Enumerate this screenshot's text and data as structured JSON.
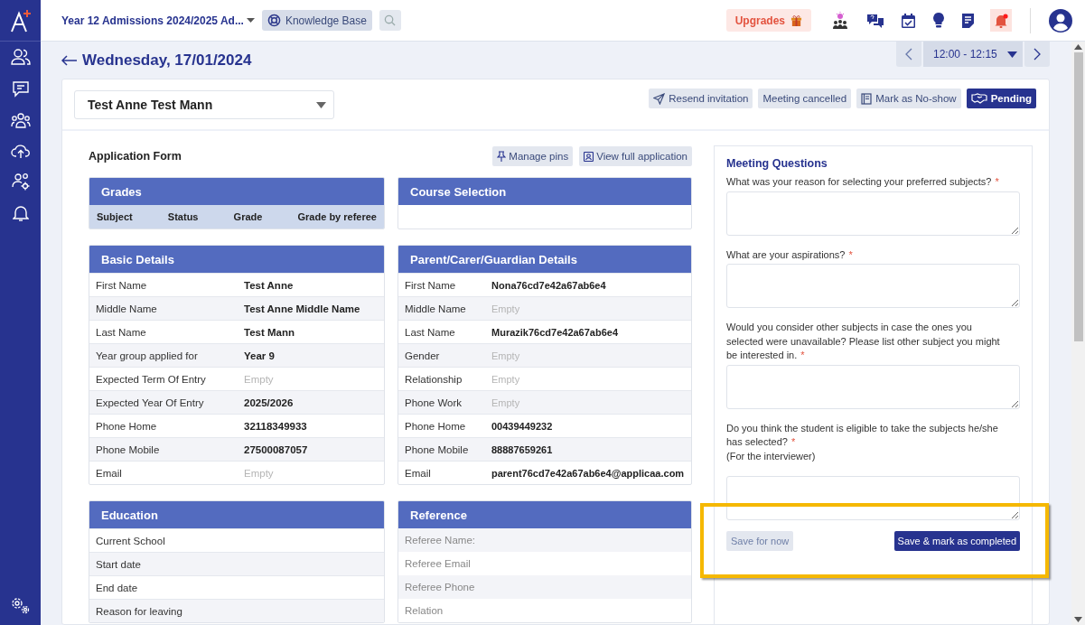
{
  "topbar": {
    "program": "Year 12 Admissions 2024/2025 Ad...",
    "knowledge_base": "Knowledge Base",
    "upgrades": "Upgrades",
    "notifications_unread": true
  },
  "header": {
    "date": "Wednesday, 17/01/2024",
    "time_slot": "12:00 - 12:15"
  },
  "applicant": {
    "name": "Test Anne Test Mann"
  },
  "actions": [
    {
      "label": "Resend invitation",
      "kind": "resend",
      "selected": false
    },
    {
      "label": "Meeting cancelled",
      "kind": "plain",
      "selected": false
    },
    {
      "label": "Mark as No-show",
      "kind": "noshow",
      "selected": false
    },
    {
      "label": "Pending",
      "kind": "pending",
      "selected": true
    }
  ],
  "application_form": {
    "title": "Application Form",
    "buttons": [
      {
        "label": "Manage pins",
        "kind": "pin"
      },
      {
        "label": "View full application",
        "kind": "view"
      }
    ],
    "sections": [
      {
        "title": "Grades",
        "kind": "columns",
        "columns": [
          "Subject",
          "Status",
          "Grade",
          "Grade by referee"
        ]
      },
      {
        "title": "Course Selection",
        "kind": "blank"
      },
      {
        "title": "Basic Details",
        "kind": "details",
        "rows": [
          {
            "label": "First Name",
            "value": "Test Anne",
            "empty": false
          },
          {
            "label": "Middle Name",
            "value": "Test Anne Middle Name",
            "empty": false
          },
          {
            "label": "Last Name",
            "value": "Test Mann",
            "empty": false
          },
          {
            "label": "Year group applied for",
            "value": "Year 9",
            "empty": false
          },
          {
            "label": "Expected Term Of Entry",
            "value": "Empty",
            "empty": true
          },
          {
            "label": "Expected Year Of Entry",
            "value": "2025/2026",
            "empty": false
          },
          {
            "label": "Phone Home",
            "value": "32118349933",
            "empty": false
          },
          {
            "label": "Phone Mobile",
            "value": "27500087057",
            "empty": false
          },
          {
            "label": "Email",
            "value": "Empty",
            "empty": true
          }
        ]
      },
      {
        "title": "Parent/Carer/Guardian Details",
        "kind": "details",
        "rows": [
          {
            "label": "First Name",
            "value": "Nona76cd7e42a67ab6e4",
            "empty": false
          },
          {
            "label": "Middle Name",
            "value": "Empty",
            "empty": true
          },
          {
            "label": "Last Name",
            "value": "Murazik76cd7e42a67ab6e4",
            "empty": false
          },
          {
            "label": "Gender",
            "value": "Empty",
            "empty": true
          },
          {
            "label": "Relationship",
            "value": "Empty",
            "empty": true
          },
          {
            "label": "Phone Work",
            "value": "Empty",
            "empty": true
          },
          {
            "label": "Phone Home",
            "value": "00439449232",
            "empty": false
          },
          {
            "label": "Phone Mobile",
            "value": "88887659261",
            "empty": false
          },
          {
            "label": "Email",
            "value": "parent76cd7e42a67ab6e4@applicaa.com",
            "empty": false
          }
        ]
      },
      {
        "title": "Education",
        "kind": "list",
        "muted": false,
        "rows": [
          "Current School",
          "Start date",
          "End date",
          "Reason for leaving"
        ]
      },
      {
        "title": "Reference",
        "kind": "list",
        "muted": true,
        "rows": [
          "Referee Name:",
          "Referee Email",
          "Referee Phone",
          "Relation"
        ]
      }
    ]
  },
  "meeting_questions": {
    "title": "Meeting Questions",
    "questions": [
      {
        "text": "What was your reason for selecting your preferred subjects?",
        "required_mark": "*"
      },
      {
        "text": "What are your aspirations?",
        "required_mark": "*"
      },
      {
        "text": "Would you consider other subjects in case the ones you selected were unavailable? Please list other subject you might be interested in.",
        "required_mark": "*"
      },
      {
        "text": "Do you think the student is eligible to take the subjects he/she has selected?",
        "required_mark": "*",
        "note": "(For the interviewer)"
      }
    ],
    "save_for_now": "Save for now",
    "save_complete": "Save & mark as completed",
    "highlighted": true
  }
}
